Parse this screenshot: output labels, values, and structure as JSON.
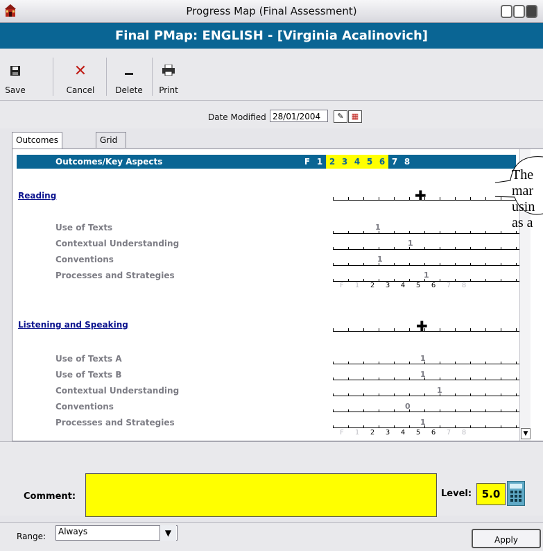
{
  "window": {
    "title": "Progress Map (Final Assessment)"
  },
  "header": {
    "title": "Final PMap: ENGLISH - [Virginia Acalinovich]"
  },
  "toolbar": {
    "save_label": "Save",
    "cancel_label": "Cancel",
    "delete_label": "Delete",
    "print_label": "Print"
  },
  "date": {
    "label": "Date Modified",
    "value": "28/01/2004"
  },
  "tabs": [
    "Outcomes Entry",
    "Grid Entry"
  ],
  "table_header": {
    "label": "Outcomes/Key Aspects",
    "levels": [
      "F",
      "1",
      "2",
      "3",
      "4",
      "5",
      "6",
      "7",
      "8"
    ]
  },
  "sections": [
    {
      "name": "Reading",
      "overall_level": 4,
      "rows": [
        {
          "label": "Use of Texts",
          "mark": "1",
          "level": 3
        },
        {
          "label": "Contextual Understanding",
          "mark": "1",
          "level": 4
        },
        {
          "label": "Conventions",
          "mark": "1",
          "level": 3
        },
        {
          "label": "Processes and Strategies",
          "mark": "1",
          "level": 5
        }
      ],
      "axis": [
        "F",
        "1",
        "2",
        "3",
        "4",
        "5",
        "6",
        "7",
        "8"
      ]
    },
    {
      "name": "Listening and Speaking",
      "overall_level": 5,
      "rows": [
        {
          "label": "Use of Texts A",
          "mark": "1",
          "level": 5
        },
        {
          "label": "Use of Texts B",
          "mark": "1",
          "level": 5
        },
        {
          "label": "Contextual Understanding",
          "mark": "1",
          "level": 6
        },
        {
          "label": "Conventions",
          "mark": "0",
          "level": 4
        },
        {
          "label": "Processes and Strategies",
          "mark": "1",
          "level": 5
        }
      ],
      "axis": [
        "F",
        "1",
        "2",
        "3",
        "4",
        "5",
        "6",
        "7",
        "8"
      ]
    }
  ],
  "callout": {
    "lines": [
      "The",
      "mar",
      "usin",
      "as a"
    ]
  },
  "comment": {
    "label": "Comment:",
    "value": ""
  },
  "level": {
    "label": "Level:",
    "value": "5.0"
  },
  "range": {
    "label": "Range:",
    "value": "Always"
  },
  "apply_label": "Apply",
  "colors": {
    "header_blue": "#0a6594",
    "highlight_yellow": "#ffff00",
    "link_blue": "#0b138e"
  }
}
